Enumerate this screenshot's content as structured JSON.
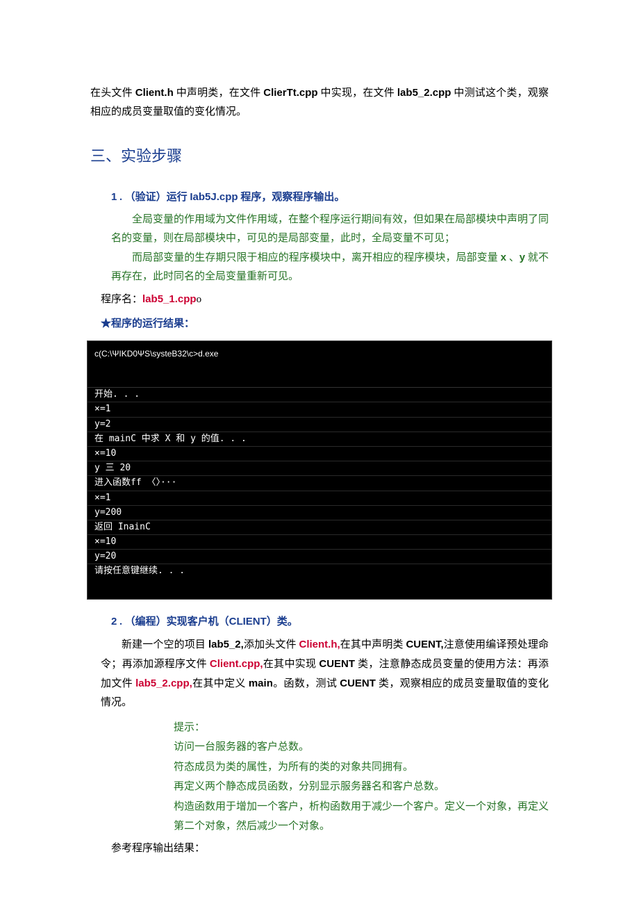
{
  "intro": {
    "prefix": "在头文件 ",
    "file1": "Client.h",
    "mid1": " 中声明类，在文件 ",
    "file2": "ClierTt.cpp",
    "mid2": " 中实现，在文件 ",
    "file3": "lab5_2.cpp",
    "suffix": " 中测试这个类，观察相应的成员变量取值的变化情况。"
  },
  "section_heading": "三、实验步骤",
  "sub1": {
    "num": "1",
    "dot": " .",
    "label_prefix": "（验证）运行 ",
    "prog": "Iab5J.cpp",
    "label_suffix": " 程序，观察程序输出。"
  },
  "green1": {
    "p1_a": "全局变量的作用域为文件作用域，在整个程序运行期间有效，但如果在局部模块中声明了同名的变量，则在局部模块中，可见的是局部变量，此时，全局变量不可见；",
    "p2_a": "而局部变量的生存期只限于相应的程序模块中，离开相应的程序模块，局部变量 ",
    "var_x": "x",
    "p2_b": " 、",
    "var_y": "y",
    "p2_c": " 就不再存在，此时同名的全局变量重新可见。"
  },
  "prog_name": {
    "label": "程序名：",
    "value": "lab5_1.cpp",
    "tail": "o"
  },
  "star_line": "★程序的运行结果：",
  "console": {
    "title": "c(C:\\ΨIKD0ΨS\\systeB32\\c>d.exe",
    "lines": [
      "开始. . .",
      "×=1",
      "y=2",
      "在 mainC 中求 X 和 y 的值. . .",
      "×=10",
      "y 三 20",
      "进入函数ff 〈〉···",
      "×=1",
      "y=200",
      "返回 InainC",
      "×=10",
      "y=20",
      "请按任意键继续. . ."
    ]
  },
  "sub2": {
    "num": "2",
    "dot": " .",
    "label_prefix": "（编程）实现客户机（",
    "cls": "CLIENT",
    "label_suffix": "）类。"
  },
  "body2": {
    "t1": "新建一个空的项目 ",
    "b1": "lab5_2,",
    "t2": "添加头文件 ",
    "r1": "Client.h,",
    "t3": "在其中声明类 ",
    "b2": "CUENT,",
    "t4": "注意使用编译预处理命令；再添加源程序文件 ",
    "r2": "Client.cpp,",
    "t5": "在其中实现 ",
    "b3": "CUENT",
    "t6": " 类，注意静态成员变量的使用方法：再添加文件 ",
    "r3": "lab5_2.cpp,",
    "t7": "在其中定义 ",
    "b4": "main",
    "t8": "。函数，测试 ",
    "b5": "CUENT",
    "t9": " 类，观察相应的成员变量取值的变化情况。"
  },
  "hints": [
    "提示：",
    "访问一台服务器的客户总数。",
    "符态成员为类的属性，为所有的类的对象共同拥有。",
    "再定义两个静态成员函数，分别显示服务器名和客户总数。",
    "构造函数用于增加一个客户，析构函数用于减少一个客户。定义一个对象，再定义第二个对象，然后减少一个对象。"
  ],
  "ref_output": "参考程序输出结果："
}
